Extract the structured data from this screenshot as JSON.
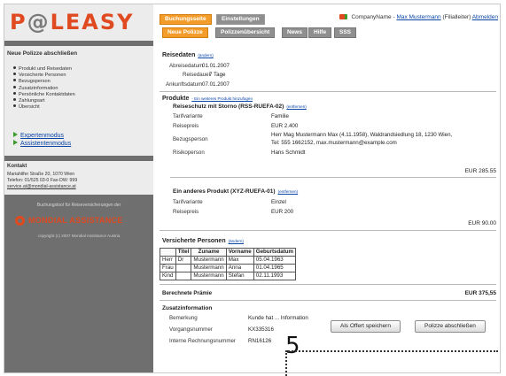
{
  "logo": {
    "text_before": "P",
    "mark": "@",
    "text_after": "LEASY"
  },
  "sidebar": {
    "heading": "Neue Polizze abschließen",
    "steps": [
      "Produkt und Reisedaten",
      "Versicherte Personen",
      "Bezugsperson",
      "Zusatzinformation",
      "Persönliche Kontaktdaten",
      "Zahlungsart",
      "Übersicht"
    ],
    "mode_links": [
      "Expertenmodus",
      "Assistentenmodus"
    ],
    "contact": {
      "heading": "Kontakt",
      "address": "Mariahilfer Straße 20, 1070 Wien",
      "phone": "Telefon: 01/525 03-0 Fax-DW: 999",
      "email": "service.at@mondial-assistance.at"
    },
    "partner_note": "Buchungstool für Reiseversicherungen der",
    "partner_name": "MONDIAL ASSISTANCE",
    "copyright": "copyright (c) 2007 Mondial Assistance Austria"
  },
  "main_tabs": [
    "Buchungsseite",
    "Einstellungen"
  ],
  "company": {
    "name": "CompanyName",
    "separator": "-",
    "user": "Max Mustermann",
    "role": "(Filialleiter)",
    "logout": "Abmelden"
  },
  "sub_tabs": [
    "Neue Polizze",
    "Polizzenübersicht",
    "News",
    "Hilfe",
    "SSS"
  ],
  "reisedaten": {
    "title": "Reisedaten",
    "change": "(ändern)",
    "rows": [
      {
        "label": "Abreisedatum",
        "value": "01.01.2007"
      },
      {
        "label": "Reisedauer",
        "value": "7 Tage"
      },
      {
        "label": "Ankunftsdatum",
        "value": "07.01.2007"
      }
    ]
  },
  "produkte": {
    "title": "Produkte",
    "add_link": "- Ein weiteres Produkt hinzufügen",
    "items": [
      {
        "name": "Reiseschutz mit Storno (RSS-RUEFA-02)",
        "remove": "(entfernen)",
        "rows": [
          {
            "label": "Tarifvariante",
            "value": "Familie"
          },
          {
            "label": "Reisepreis",
            "value": "EUR 2.400"
          },
          {
            "label": "Bezugsperson",
            "value": "Herr Mag Mustermann Max (4.11.1958), Waldrandsiedlung 18, 1230 Wien,"
          },
          {
            "label": "",
            "value": "Tel: 555 1662152, max.mustermann@example.com"
          },
          {
            "label": "Risikoperson",
            "value": "Hans Schmidt"
          }
        ],
        "total": "EUR 285.55"
      },
      {
        "name": "Ein anderes Produkt (XYZ-RUEFA-01)",
        "remove": "(entfernen)",
        "rows": [
          {
            "label": "Tarifvariante",
            "value": "Einzel"
          },
          {
            "label": "Reisepreis",
            "value": "EUR 200"
          }
        ],
        "total": "EUR 90.00"
      }
    ]
  },
  "personen": {
    "title": "Versicherte Personen",
    "change": "(ändern)",
    "columns": [
      "",
      "Titel",
      "Zuname",
      "Vorname",
      "Geburtsdatum"
    ],
    "rows": [
      [
        "Herr",
        "Dr",
        "Mustermann",
        "Max",
        "05.04.1963"
      ],
      [
        "Frau",
        "",
        "Mustermann",
        "Anna",
        "01.04.1965"
      ],
      [
        "Kind",
        "",
        "Mustermann",
        "Stefan",
        "02.11.1993"
      ]
    ]
  },
  "praemie": {
    "label": "Berechnete Prämie",
    "value": "EUR 375,55"
  },
  "zusatz": {
    "title": "Zusatzinformation",
    "rows": [
      {
        "label": "Bemerkung",
        "value": "Kunde hat ... Information"
      },
      {
        "label": "Vorgangsnummer",
        "value": "KX335316"
      },
      {
        "label": "Interne Rechnungsnummer",
        "value": "RN16126"
      }
    ]
  },
  "buttons": {
    "save_offer": "Als Offert speichern",
    "finish": "Polizze abschließen"
  },
  "callout": "5",
  "colors": {
    "accent_orange": "#f39c2a",
    "brand_red": "#e04a20",
    "sidebar_gray": "#6f6f6f",
    "link_blue": "#0a46a8"
  }
}
